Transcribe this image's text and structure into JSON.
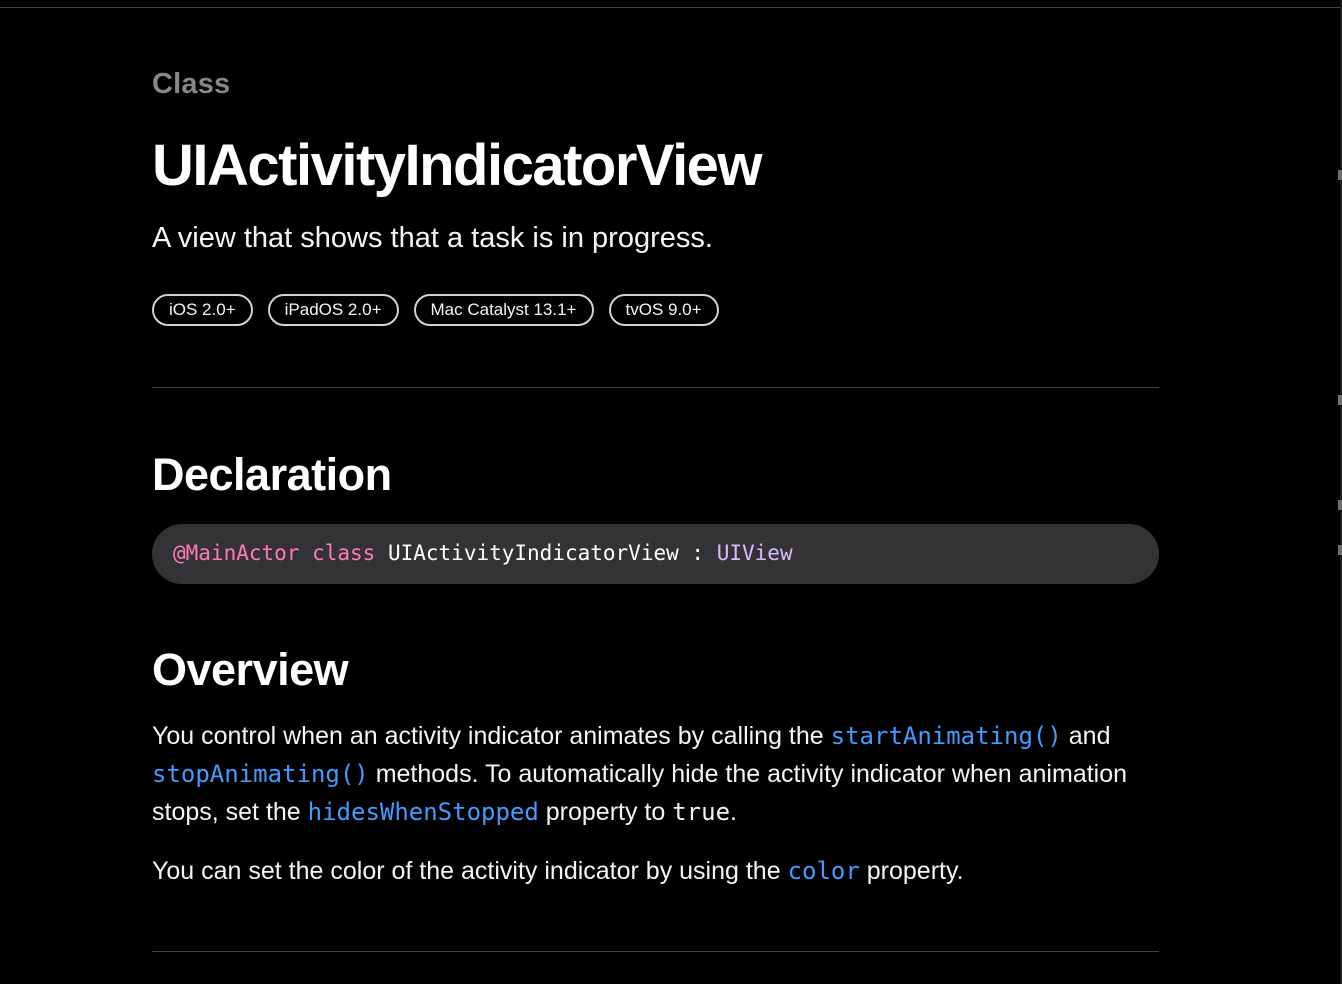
{
  "header": {
    "eyebrow": "Class",
    "title": "UIActivityIndicatorView",
    "abstract": "A view that shows that a task is in progress."
  },
  "availability": [
    "iOS 2.0+",
    "iPadOS 2.0+",
    "Mac Catalyst 13.1+",
    "tvOS 9.0+"
  ],
  "declaration": {
    "heading": "Declaration",
    "attribute": "@MainActor",
    "keyword": "class",
    "name": "UIActivityIndicatorView",
    "separator": ":",
    "superclass": "UIView"
  },
  "overview": {
    "heading": "Overview",
    "p1": {
      "t1": "You control when an activity indicator animates by calling the ",
      "link1": "startAnimating()",
      "t2": " and ",
      "link2": "stopAnimating()",
      "t3": " methods. To automatically hide the activity indicator when animation stops, set the ",
      "link3": "hidesWhenStopped",
      "t4": " property to ",
      "code1": "true",
      "t5": "."
    },
    "p2": {
      "t1": "You can set the color of the activity indicator by using the ",
      "link1": "color",
      "t2": " property."
    }
  },
  "colors": {
    "background": "#000000",
    "link": "#419cff",
    "keyword": "#ff7ab2",
    "type": "#dabaff",
    "eyebrow": "#86868b",
    "code_background": "#333336"
  }
}
